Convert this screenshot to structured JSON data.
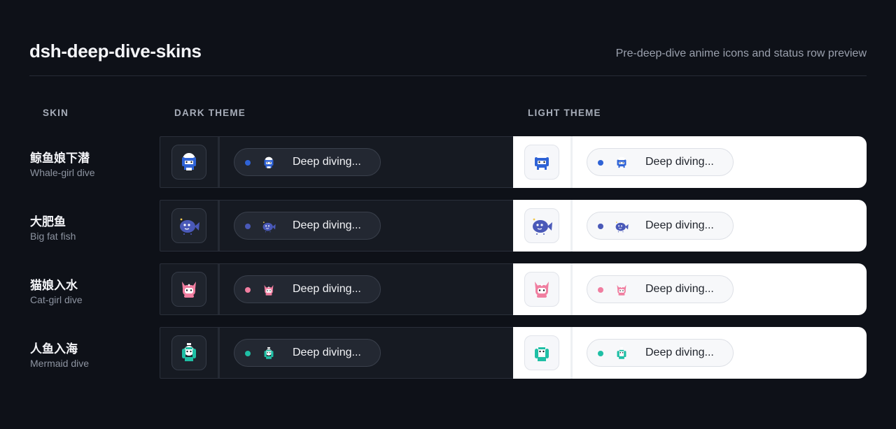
{
  "header": {
    "title": "dsh-deep-dive-skins",
    "subtitle": "Pre-deep-dive anime icons and status row preview"
  },
  "columns": {
    "skin": "SKIN",
    "dark": "DARK THEME",
    "light": "LIGHT THEME"
  },
  "status_text": "Deep diving...",
  "skins": [
    {
      "name": "鲸鱼娘下潜",
      "sub": "Whale-girl dive",
      "icon": "whale-girl-icon",
      "color": "#2f63d6"
    },
    {
      "name": "大肥鱼",
      "sub": "Big fat fish",
      "icon": "fat-fish-icon",
      "color": "#4a59b8"
    },
    {
      "name": "猫娘入水",
      "sub": "Cat-girl dive",
      "icon": "cat-girl-icon",
      "color": "#f07ea0"
    },
    {
      "name": "人鱼入海",
      "sub": "Mermaid dive",
      "icon": "mermaid-icon",
      "color": "#1fbfa5"
    }
  ]
}
